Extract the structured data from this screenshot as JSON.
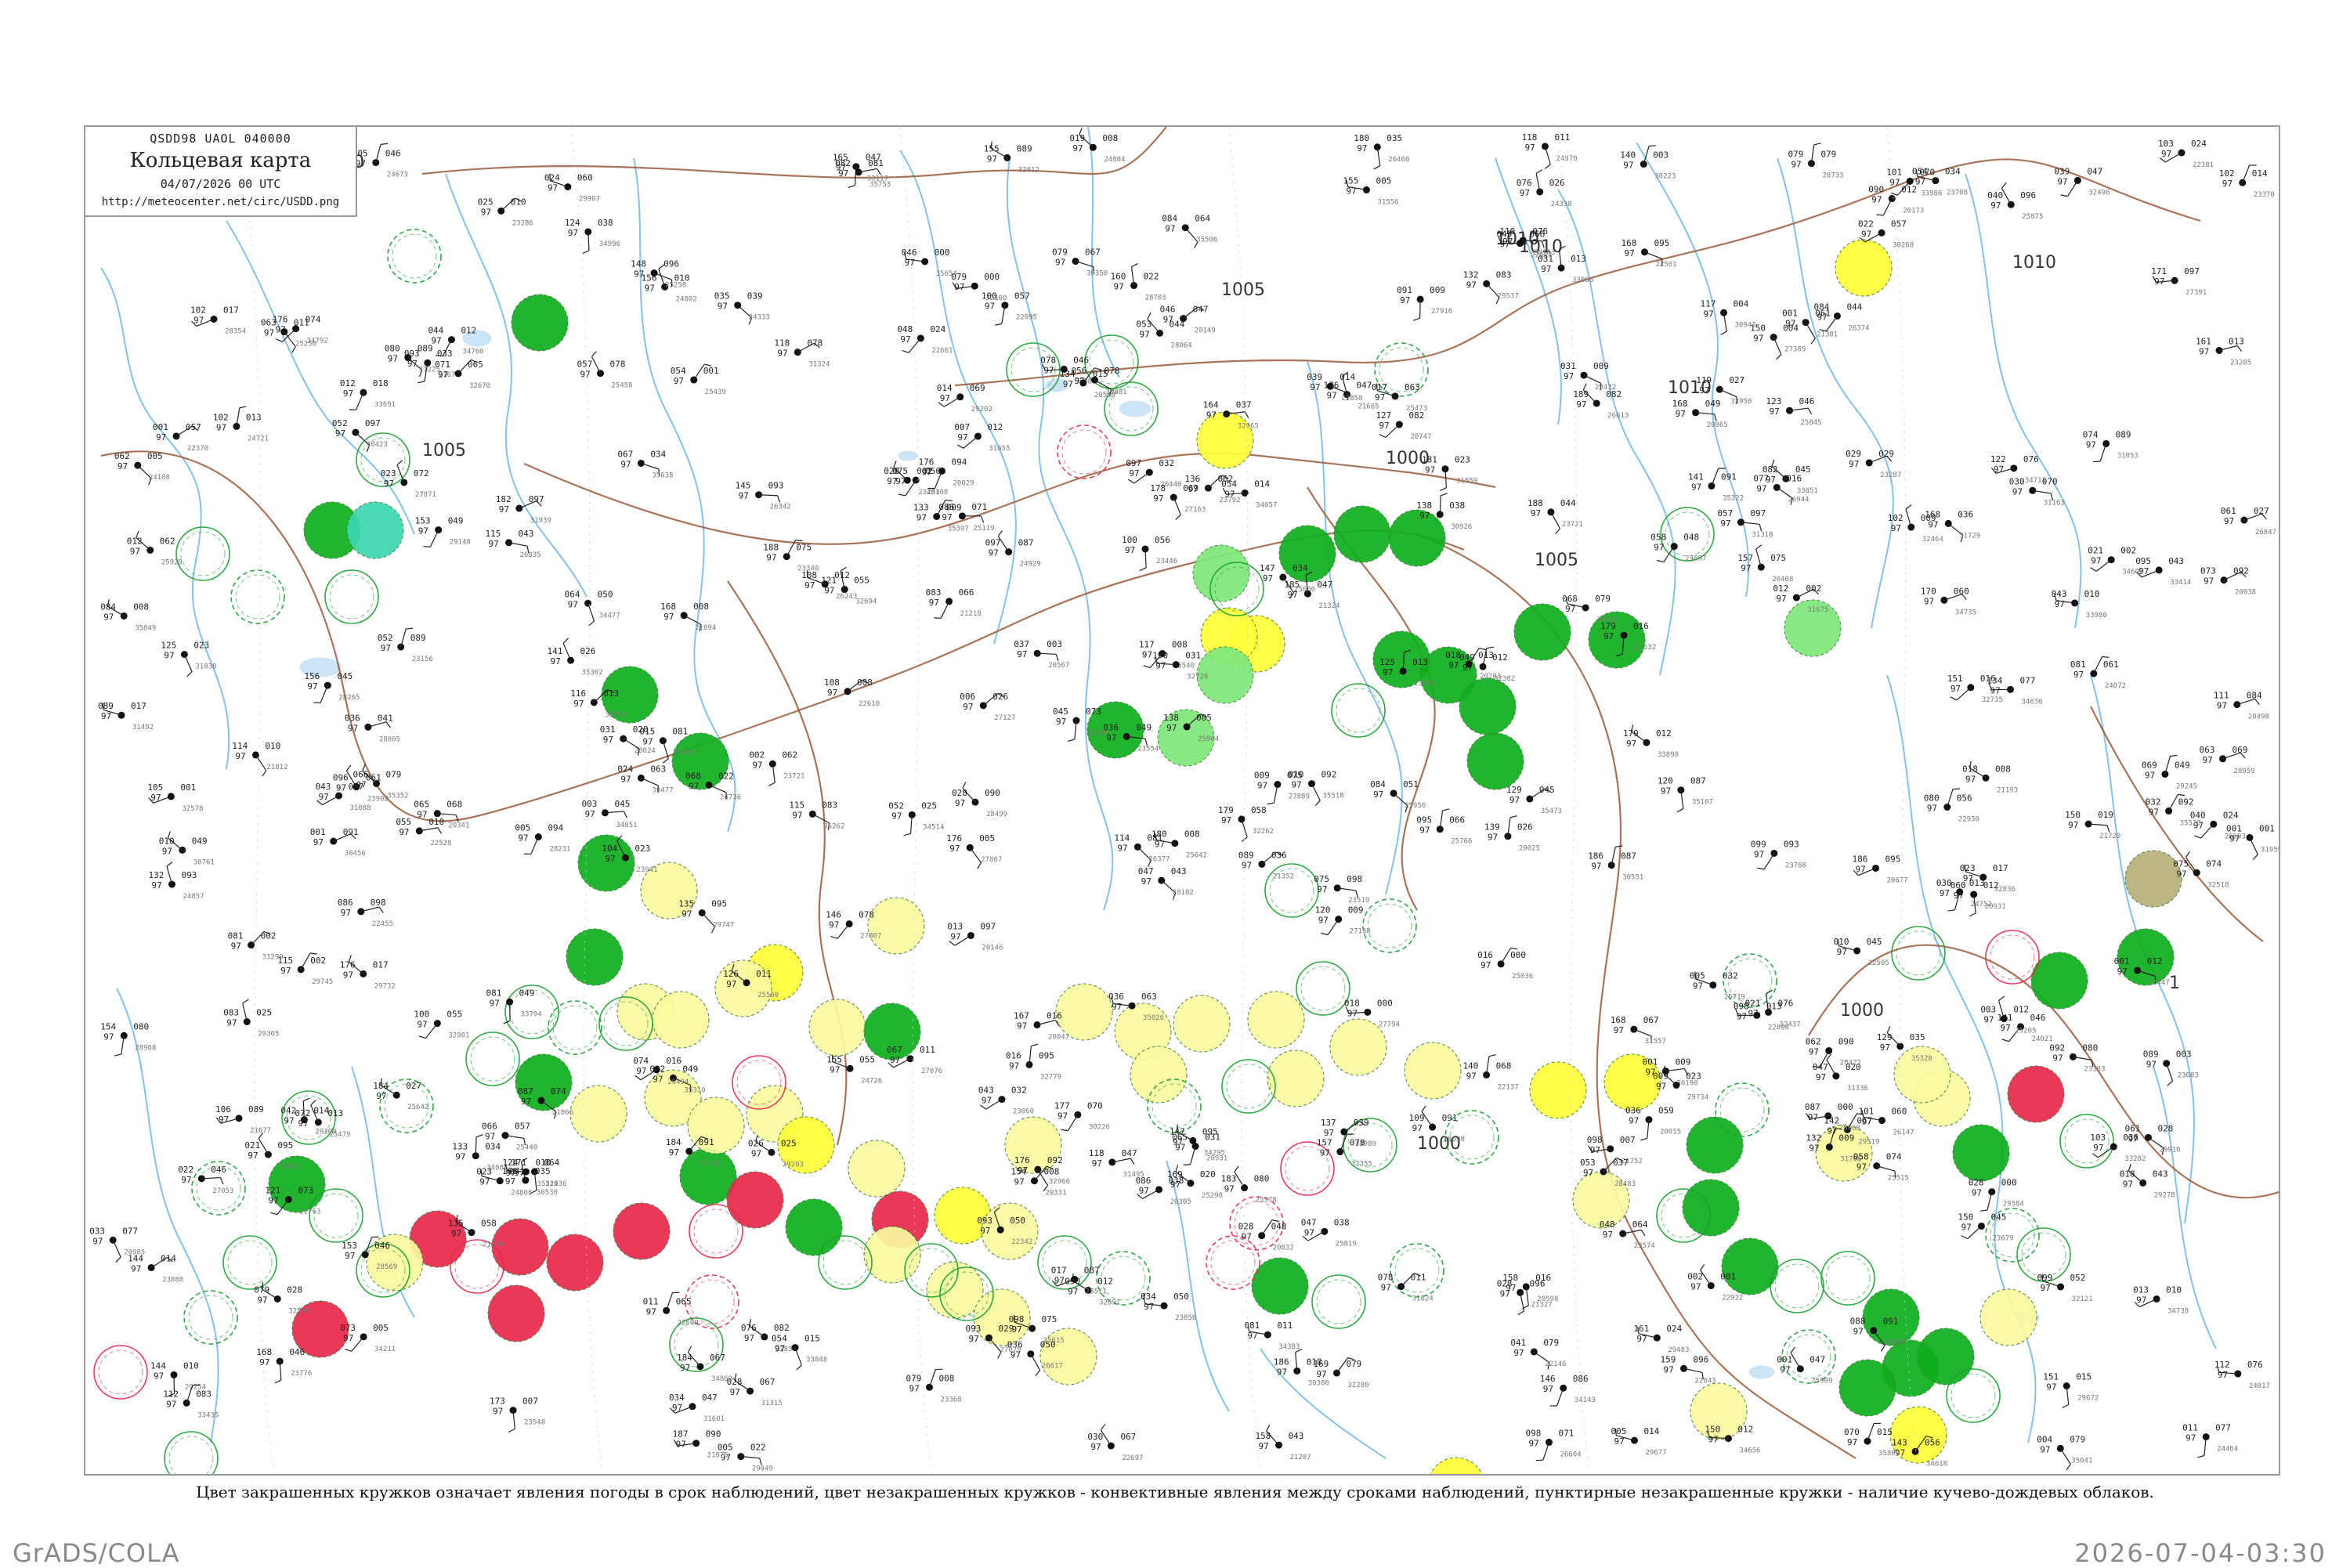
{
  "header": {
    "codes": "QSDD98  UAOL  040000",
    "title": "Кольцевая карта",
    "time": "04/07/2026 00 UTC",
    "url": "http://meteocenter.net/circ/USDD.png"
  },
  "isobars": {
    "labels": [
      "1010",
      "1010",
      "1010",
      "1010",
      "1010",
      "1005",
      "1005",
      "1005",
      "1000",
      "1000",
      "1000",
      "1"
    ]
  },
  "legend_note": "Цвет закрашенных кружков означает явления погоды в срок наблюдений, цвет незакрашенных кружков - конвективные явления между сроками наблюдений, пунктирные незакрашенные кружки - наличие кучево-дождевых облаков.",
  "footer": {
    "left": "GrADS/COLA",
    "right": "2026-07-04-03:30"
  },
  "colors": {
    "rain_green": "#0fae1e",
    "shower_light_green": "#7ee87a",
    "thunder_red": "#e8284a",
    "fog_yellow": "#ffff3a",
    "haze_pale_yellow": "#fafaa0",
    "drizzle_teal": "#3dd6b0",
    "dust_olive": "#b6b07a",
    "isobar": "#9a5a3a",
    "river": "#6eb6e8",
    "station_text": "#222222"
  },
  "station_legend": {
    "filled_circle": "present weather at observation time",
    "open_circle": "convective phenomena between observations",
    "dashed_circle": "cumulonimbus clouds present"
  }
}
